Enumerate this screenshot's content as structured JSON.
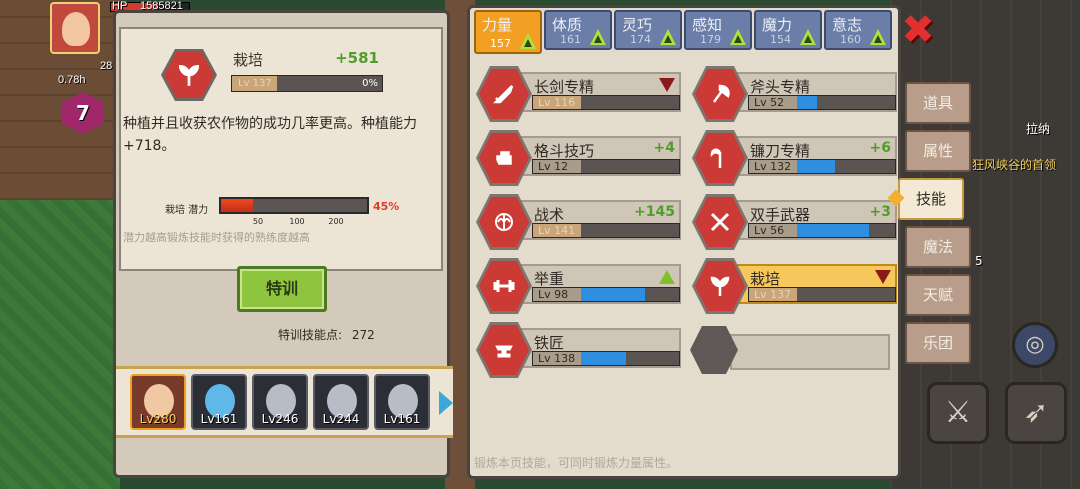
{
  "hud": {
    "hp_label": "HP",
    "hp_value": "1585821",
    "time_label": "0.78h",
    "level_gem": "7",
    "stat_28": "28"
  },
  "detail": {
    "name": "栽培",
    "bonus": "+581",
    "level": "Lv 137",
    "progress_pct": "0%",
    "description": "种植并且收获农作物的成功几率更高。种植能力+718。",
    "potential_label": "栽培 潜力",
    "potential_ticks": [
      "50",
      "100",
      "200"
    ],
    "potential_pct": "45%",
    "potential_fill": 0.22,
    "hint": "潜力越高锻炼技能时获得的熟练度越高"
  },
  "train": {
    "button_label": "特训",
    "points_label": "特训技能点:",
    "points_value": "272"
  },
  "heroes": [
    {
      "level": "Lv280",
      "active": true
    },
    {
      "level": "Lv161",
      "active": false
    },
    {
      "level": "Lv246",
      "active": false
    },
    {
      "level": "Lv244",
      "active": false
    },
    {
      "level": "Lv161",
      "active": false
    }
  ],
  "stat_tabs": [
    {
      "name": "力量",
      "value": "157",
      "active": true
    },
    {
      "name": "体质",
      "value": "161",
      "active": false
    },
    {
      "name": "灵巧",
      "value": "174",
      "active": false
    },
    {
      "name": "感知",
      "value": "179",
      "active": false
    },
    {
      "name": "魔力",
      "value": "154",
      "active": false
    },
    {
      "name": "意志",
      "value": "160",
      "active": false
    }
  ],
  "skills": [
    {
      "name": "长剑专精",
      "level": "Lv 116",
      "bonus": "",
      "fill": 0.0,
      "mark": "down",
      "gold": true,
      "icon": "sword-icon"
    },
    {
      "name": "斧头专精",
      "level": "Lv 52",
      "bonus": "",
      "fill": 0.2,
      "mark": "",
      "gold": false,
      "icon": "axe-icon"
    },
    {
      "name": "格斗技巧",
      "level": "Lv 12",
      "bonus": "+4",
      "fill": 0.0,
      "mark": "",
      "gold": false,
      "icon": "fist-icon"
    },
    {
      "name": "镰刀专精",
      "level": "Lv 132",
      "bonus": "+6",
      "fill": 0.38,
      "mark": "",
      "gold": false,
      "icon": "scythe-icon"
    },
    {
      "name": "战术",
      "level": "Lv 141",
      "bonus": "+145",
      "fill": 0.0,
      "mark": "",
      "gold": true,
      "icon": "tactics-icon"
    },
    {
      "name": "双手武器",
      "level": "Lv 56",
      "bonus": "+3",
      "fill": 0.72,
      "mark": "",
      "gold": false,
      "icon": "greatsword-icon"
    },
    {
      "name": "举重",
      "level": "Lv 98",
      "bonus": "",
      "fill": 0.64,
      "mark": "up",
      "gold": false,
      "icon": "dumbbell-icon"
    },
    {
      "name": "栽培",
      "level": "Lv 137",
      "bonus": "",
      "fill": 0.0,
      "mark": "down",
      "gold": true,
      "icon": "sprout-icon",
      "selected": true
    },
    {
      "name": "铁匠",
      "level": "Lv 138",
      "bonus": "",
      "fill": 0.45,
      "mark": "",
      "gold": false,
      "icon": "anvil-icon"
    }
  ],
  "footer_hint": "锻炼本页技能，可同时锻炼力量属性。",
  "side_menu": [
    {
      "label": "道具",
      "active": false
    },
    {
      "label": "属性",
      "active": false
    },
    {
      "label": "技能",
      "active": true
    },
    {
      "label": "魔法",
      "active": false
    },
    {
      "label": "天赋",
      "active": false
    },
    {
      "label": "乐团",
      "active": false
    }
  ],
  "world": {
    "npc_name": "拉纳",
    "location": "狂风峡谷的首领",
    "slot_count": "5"
  },
  "colors": {
    "accent_red": "#cc3a36",
    "tab_active": "#f2a023",
    "train_green": "#8fc43f",
    "progress_blue": "#2e8fe0"
  }
}
